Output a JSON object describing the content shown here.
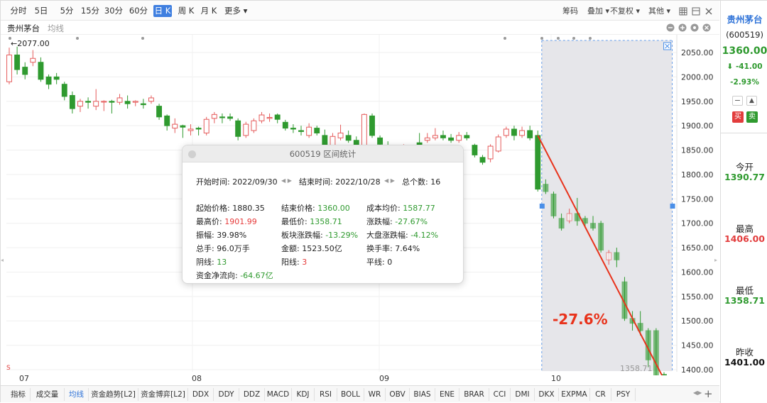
{
  "toolbar": {
    "periods": [
      "分时",
      "5日",
      "5分",
      "15分",
      "30分",
      "60分",
      "日 K",
      "周 K",
      "月 K",
      "更多 ▾"
    ],
    "active_index": 6,
    "right_items": [
      "筹码",
      "叠加 ▾",
      "不复权 ▾",
      "其他 ▾"
    ]
  },
  "subheader": {
    "stock_name": "贵州茅台",
    "indicator": "均线"
  },
  "chart_data": {
    "type": "candlestick",
    "y_ticks": [
      "2050.00",
      "2000.00",
      "1950.00",
      "1900.00",
      "1850.00",
      "1800.00",
      "1750.00",
      "1700.00",
      "1650.00",
      "1600.00",
      "1550.00",
      "1500.00",
      "1450.00",
      "1400.00"
    ],
    "x_ticks": [
      "07",
      "08",
      "09",
      "10"
    ],
    "ylim": [
      1358,
      2080
    ],
    "grid": true,
    "high_label": "2077.00",
    "low_label": "1358.71",
    "annotation": "-27.6%",
    "s_marker": "S",
    "candles": [
      [
        1990,
        2045,
        1985,
        2060
      ],
      [
        2045,
        2015,
        2005,
        2062
      ],
      [
        2020,
        2005,
        1995,
        2030
      ],
      [
        2030,
        2038,
        2022,
        2055
      ],
      [
        2030,
        1995,
        1990,
        2040
      ],
      [
        2000,
        1985,
        1975,
        2005
      ],
      [
        2000,
        1995,
        1985,
        2008
      ],
      [
        1985,
        1960,
        1952,
        1990
      ],
      [
        1962,
        1935,
        1925,
        1970
      ],
      [
        1940,
        1950,
        1928,
        1955
      ],
      [
        1950,
        1948,
        1935,
        1958
      ],
      [
        1940,
        1950,
        1932,
        1975
      ],
      [
        1950,
        1950,
        1930,
        1952
      ],
      [
        1950,
        1948,
        1925,
        1953
      ],
      [
        1948,
        1957,
        1943,
        1965
      ],
      [
        1950,
        1945,
        1935,
        1962
      ],
      [
        1948,
        1950,
        1940,
        1952
      ],
      [
        1945,
        1943,
        1935,
        1955
      ],
      [
        1950,
        1957,
        1945,
        1962
      ],
      [
        1940,
        1918,
        1912,
        1945
      ],
      [
        1920,
        1900,
        1890,
        1923
      ],
      [
        1895,
        1903,
        1885,
        1915
      ],
      [
        1900,
        1897,
        1875,
        1902
      ],
      [
        1890,
        1893,
        1880,
        1903
      ],
      [
        1895,
        1893,
        1880,
        1898
      ],
      [
        1885,
        1913,
        1880,
        1918
      ],
      [
        1915,
        1923,
        1905,
        1928
      ],
      [
        1918,
        1917,
        1905,
        1925
      ],
      [
        1918,
        1915,
        1910,
        1925
      ],
      [
        1910,
        1878,
        1870,
        1915
      ],
      [
        1880,
        1903,
        1875,
        1908
      ],
      [
        1890,
        1910,
        1885,
        1915
      ],
      [
        1910,
        1922,
        1905,
        1928
      ],
      [
        1915,
        1917,
        1908,
        1925
      ],
      [
        1922,
        1913,
        1905,
        1925
      ],
      [
        1907,
        1895,
        1890,
        1912
      ],
      [
        1895,
        1893,
        1885,
        1903
      ],
      [
        1890,
        1888,
        1880,
        1900
      ],
      [
        1880,
        1897,
        1875,
        1905
      ],
      [
        1895,
        1885,
        1880,
        1900
      ],
      [
        1880,
        1860,
        1855,
        1892
      ],
      [
        1860,
        1878,
        1850,
        1885
      ],
      [
        1875,
        1885,
        1870,
        1902
      ],
      [
        1880,
        1870,
        1865,
        1890
      ],
      [
        1870,
        1860,
        1855,
        1878
      ],
      [
        1860,
        1923,
        1855,
        1925
      ],
      [
        1920,
        1880,
        1875,
        1925
      ],
      [
        1875,
        1862,
        1850,
        1880
      ],
      [
        1860,
        1855,
        1850,
        1868
      ],
      [
        1855,
        1850,
        1845,
        1860
      ],
      [
        1850,
        1855,
        1848,
        1862
      ],
      [
        1850,
        1848,
        1840,
        1860
      ],
      [
        1865,
        1860,
        1855,
        1885
      ],
      [
        1870,
        1875,
        1865,
        1885
      ],
      [
        1875,
        1880,
        1870,
        1895
      ],
      [
        1880,
        1875,
        1870,
        1890
      ],
      [
        1875,
        1870,
        1865,
        1883
      ],
      [
        1870,
        1880,
        1865,
        1887
      ],
      [
        1880,
        1875,
        1870,
        1887
      ],
      [
        1860,
        1840,
        1835,
        1863
      ],
      [
        1835,
        1825,
        1820,
        1840
      ],
      [
        1832,
        1858,
        1825,
        1862
      ],
      [
        1848,
        1877,
        1845,
        1882
      ],
      [
        1880,
        1893,
        1875,
        1898
      ],
      [
        1893,
        1880,
        1870,
        1900
      ],
      [
        1880,
        1890,
        1875,
        1898
      ],
      [
        1890,
        1875,
        1870,
        1900
      ],
      [
        1880,
        1770,
        1765,
        1890
      ],
      [
        1780,
        1765,
        1760,
        1790
      ],
      [
        1760,
        1715,
        1710,
        1765
      ],
      [
        1710,
        1690,
        1685,
        1720
      ],
      [
        1705,
        1720,
        1700,
        1730
      ],
      [
        1720,
        1705,
        1695,
        1752
      ],
      [
        1710,
        1700,
        1690,
        1715
      ],
      [
        1700,
        1690,
        1685,
        1715
      ],
      [
        1700,
        1645,
        1640,
        1705
      ],
      [
        1625,
        1640,
        1615,
        1645
      ],
      [
        1640,
        1625,
        1610,
        1650
      ],
      [
        1580,
        1505,
        1500,
        1590
      ],
      [
        1505,
        1495,
        1480,
        1520
      ],
      [
        1495,
        1480,
        1470,
        1520
      ],
      [
        1480,
        1420,
        1405,
        1485
      ],
      [
        1480,
        1380,
        1372,
        1485
      ],
      [
        1390,
        1360,
        1359,
        1395
      ]
    ],
    "line_start": [
      1880,
      67
    ],
    "line_end": [
      1360,
      84
    ]
  },
  "dialog": {
    "title": "600519 区间统计",
    "start_label": "开始时间: 2022/09/30",
    "end_label": "结束时间: 2022/10/28",
    "count_label": "总个数: 16",
    "rows": [
      [
        {
          "k": "起始价格: ",
          "v": "1880.35",
          "c": ""
        },
        {
          "k": "结束价格: ",
          "v": "1360.00",
          "c": "green"
        },
        {
          "k": "成本均价: ",
          "v": "1587.77",
          "c": "green"
        }
      ],
      [
        {
          "k": "最高价: ",
          "v": "1901.99",
          "c": "red"
        },
        {
          "k": "最低价: ",
          "v": "1358.71",
          "c": "green"
        },
        {
          "k": "涨跌幅: ",
          "v": "-27.67%",
          "c": "green"
        }
      ],
      [
        {
          "k": "振幅: ",
          "v": "39.98%",
          "c": ""
        },
        {
          "k": "板块涨跌幅: ",
          "v": "-13.29%",
          "c": "green"
        },
        {
          "k": "大盘涨跌幅: ",
          "v": "-4.12%",
          "c": "green"
        }
      ],
      [
        {
          "k": "总手: ",
          "v": "96.0万手",
          "c": ""
        },
        {
          "k": "金额: ",
          "v": "1523.50亿",
          "c": ""
        },
        {
          "k": "换手率: ",
          "v": "7.64%",
          "c": ""
        }
      ],
      [
        {
          "k": "阴线: ",
          "v": "13",
          "c": "green"
        },
        {
          "k": "阳线: ",
          "v": "3",
          "c": "red"
        },
        {
          "k": "平线: ",
          "v": "0",
          "c": ""
        }
      ],
      [
        {
          "k": "资金净流向: ",
          "v": "-64.67亿",
          "c": "green"
        },
        {
          "k": "",
          "v": "",
          "c": ""
        },
        {
          "k": "",
          "v": "",
          "c": ""
        }
      ]
    ]
  },
  "tabs": [
    "指标",
    "成交量",
    "均线",
    "资金趋势[L2]",
    "资金博弈[L2]",
    "DDX",
    "DDY",
    "DDZ",
    "MACD",
    "KDJ",
    "RSI",
    "BOLL",
    "WR",
    "OBV",
    "BIAS",
    "ENE",
    "BRAR",
    "CCI",
    "DMI",
    "DKX",
    "EXPMA",
    "CR",
    "PSY"
  ],
  "active_tab": 2,
  "sidebar": {
    "name": "贵州茅台",
    "code": "(600519)",
    "price": "1360.00",
    "change": "-41.00",
    "pct": "-2.93%",
    "buy": "买",
    "sell": "卖",
    "open_label": "今开",
    "open_val": "1390.77",
    "high_label": "最高",
    "high_val": "1406.00",
    "low_label": "最低",
    "low_val": "1358.71",
    "prev_label": "昨收",
    "prev_val": "1401.00"
  },
  "colors": {
    "up": "#e55b5b",
    "down": "#2f9a2f",
    "accent": "#3f7fe0",
    "arrow": "#e8331c"
  }
}
